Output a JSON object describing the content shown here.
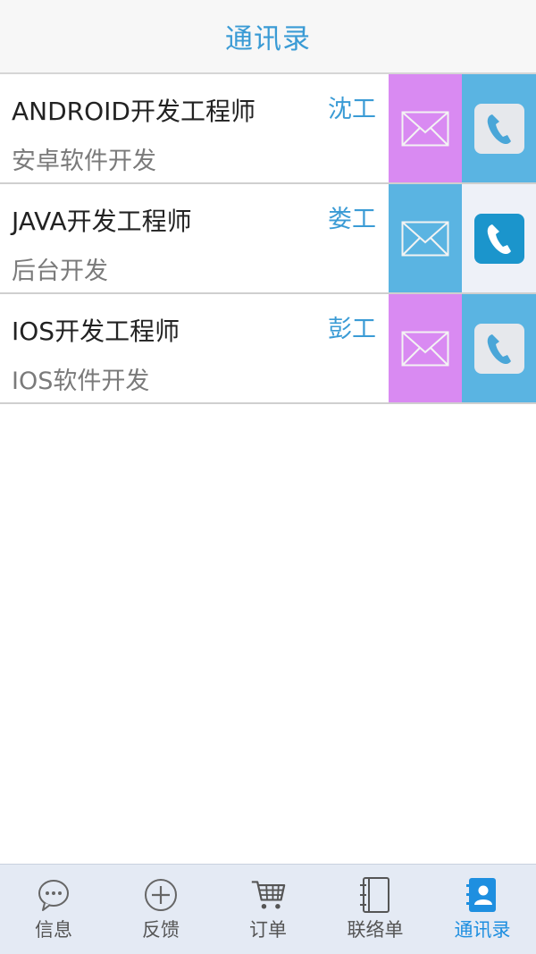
{
  "header": {
    "title": "通讯录"
  },
  "colors": {
    "accent": "#3a9bd5",
    "mail_purple": "#d98af2",
    "mail_blue": "#5ab4e2",
    "phone_blue": "#5ab4e2",
    "phone_white_bg": "#eef1f8",
    "phone_active_tile": "#1b95cc",
    "tab_active": "#1e8fe0"
  },
  "contacts": [
    {
      "job": "ANDROID开发工程师",
      "desc": "安卓软件开发",
      "person": "沈工",
      "mail_color": "purple",
      "phone_state": "normal"
    },
    {
      "job": "JAVA开发工程师",
      "desc": "后台开发",
      "person": "娄工",
      "mail_color": "blue",
      "phone_state": "pressed"
    },
    {
      "job": "IOS开发工程师",
      "desc": "IOS软件开发",
      "person": "彭工",
      "mail_color": "purple",
      "phone_state": "normal"
    }
  ],
  "tabbar": {
    "items": [
      {
        "label": "信息",
        "icon": "chat-bubble-icon"
      },
      {
        "label": "反馈",
        "icon": "plus-circle-icon"
      },
      {
        "label": "订单",
        "icon": "shopping-cart-icon"
      },
      {
        "label": "联络单",
        "icon": "notebook-icon"
      },
      {
        "label": "通讯录",
        "icon": "contacts-icon",
        "active": true
      }
    ]
  }
}
